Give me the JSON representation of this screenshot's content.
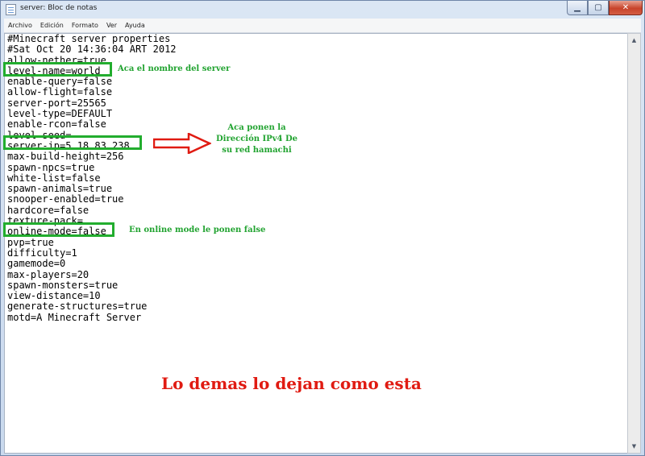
{
  "window": {
    "title": "server: Bloc de notas",
    "controls": {
      "minimize": "▁",
      "maximize": "▢",
      "close": "✕"
    },
    "icon": "notepad-icon"
  },
  "menubar": {
    "items": [
      {
        "label": "Archivo"
      },
      {
        "label": "Edición"
      },
      {
        "label": "Formato"
      },
      {
        "label": "Ver"
      },
      {
        "label": "Ayuda"
      }
    ]
  },
  "editor": {
    "lines": [
      "#Minecraft server properties",
      "#Sat Oct 20 14:36:04 ART 2012",
      "allow-nether=true",
      "level-name=world",
      "enable-query=false",
      "allow-flight=false",
      "server-port=25565",
      "level-type=DEFAULT",
      "enable-rcon=false",
      "level-seed=",
      "server-ip=5.18.83.238",
      "max-build-height=256",
      "spawn-npcs=true",
      "white-list=false",
      "spawn-animals=true",
      "snooper-enabled=true",
      "hardcore=false",
      "texture-pack=",
      "online-mode=false",
      "pvp=true",
      "difficulty=1",
      "gamemode=0",
      "max-players=20",
      "spawn-monsters=true",
      "view-distance=10",
      "generate-structures=true",
      "motd=A Minecraft Server"
    ]
  },
  "annotations": {
    "level_name_note": "Aca el nombre del server",
    "server_ip_note": [
      "Aca ponen la",
      "Dirección IPv4 De",
      "su red hamachi"
    ],
    "online_mode_note": "En online mode le ponen false",
    "footer_note": "Lo demas lo dejan como esta",
    "highlight_color": "#22ad2e",
    "arrow_color": "#e01b12"
  }
}
